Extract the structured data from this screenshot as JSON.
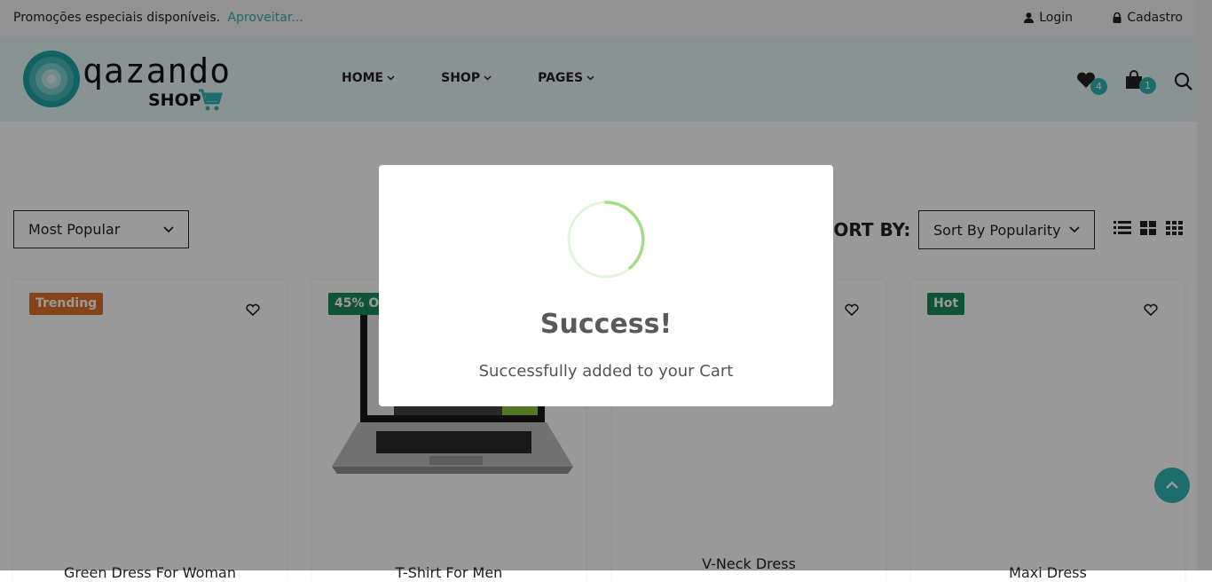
{
  "topbar": {
    "promo_text": "Promoções especiais disponíveis.",
    "promo_link": "Aproveitar...",
    "login": "Login",
    "signup": "Cadastro"
  },
  "header": {
    "brand": "qazando",
    "brand_sub": "SHOP",
    "nav": [
      {
        "label": "HOME"
      },
      {
        "label": "SHOP"
      },
      {
        "label": "PAGES"
      }
    ],
    "wishlist_count": "4",
    "cart_count": "1"
  },
  "toolbar": {
    "filter_value": "Most Popular",
    "sort_label": "SORT BY:",
    "sort_value": "Sort By Popularity"
  },
  "products": [
    {
      "tag": "Trending",
      "tag_color": "#e0712a",
      "title": "Green Dress For Woman"
    },
    {
      "tag": "45% OFF",
      "tag_color": "#1b8a5a",
      "title": "T-Shirt For Men"
    },
    {
      "tag": "",
      "tag_color": "",
      "title": "V-Neck Dress"
    },
    {
      "tag": "Hot",
      "tag_color": "#1b8a5a",
      "title": "Maxi Dress"
    }
  ],
  "modal": {
    "title": "Success!",
    "text": "Successfully added to your Cart",
    "spinner_color": "#a5dc86"
  },
  "colors": {
    "accent": "#2fb5b4"
  }
}
